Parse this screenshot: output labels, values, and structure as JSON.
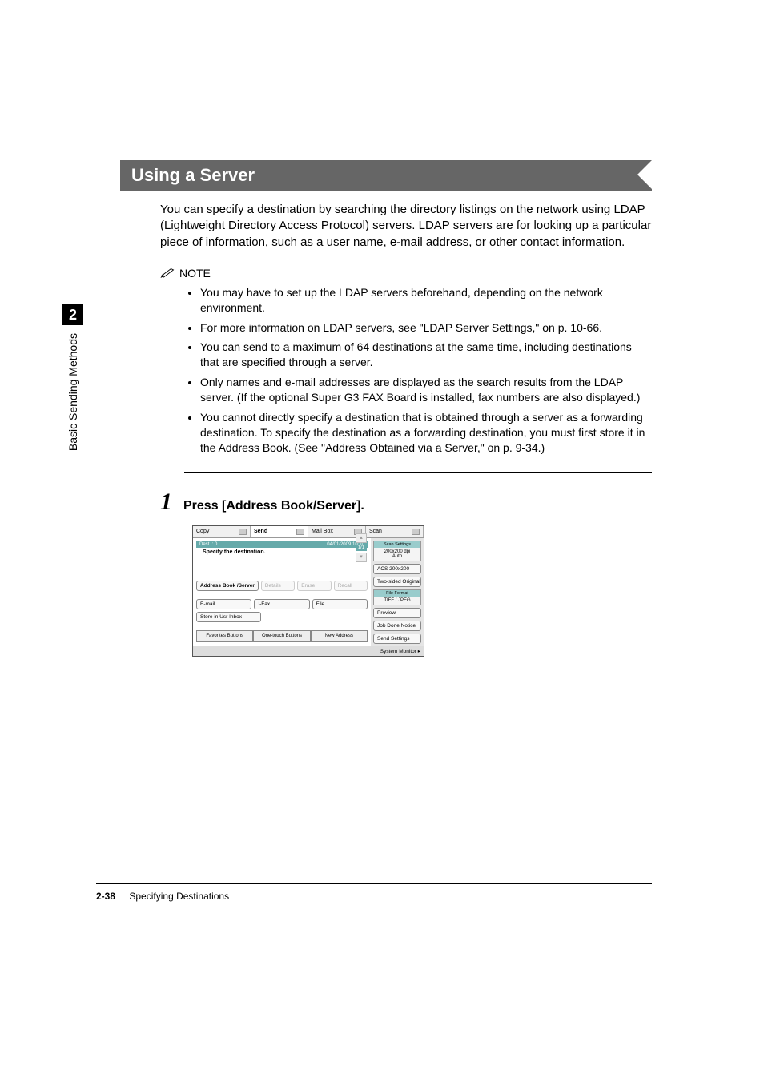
{
  "header": {
    "title": "Using a Server"
  },
  "sidetab": {
    "chapter": "2",
    "label": "Basic Sending Methods"
  },
  "intro": "You can specify a destination by searching the directory listings on the network using LDAP (Lightweight Directory Access Protocol) servers. LDAP servers are for looking up a particular piece of information, such as a user name, e-mail address, or other contact information.",
  "note": {
    "label": "NOTE",
    "items": [
      "You may have to set up the LDAP servers beforehand, depending on the network environment.",
      "For more information on LDAP servers, see \"LDAP Server Settings,\" on p. 10-66.",
      "You can send to a maximum of 64 destinations at the same time, including destinations that are specified through a server.",
      "Only names and e-mail addresses are displayed as the search results from the LDAP server. (If the optional Super G3 FAX Board is installed, fax numbers are also displayed.)",
      "You cannot directly specify a destination that is obtained through a server as a forwarding destination. To specify the destination as a forwarding destination, you must first store it in the Address Book. (See \"Address Obtained via a Server,\" on p. 9-34.)"
    ]
  },
  "step": {
    "number": "1",
    "text": "Press [Address Book/Server]."
  },
  "screenshot": {
    "tabs": {
      "copy": "Copy",
      "send": "Send",
      "mailbox": "Mail Box",
      "scan": "Scan"
    },
    "statusbar": {
      "left": "Dest. :  0",
      "right": "04/01/2009 10:10"
    },
    "prompt": "Specify the destination.",
    "pager": {
      "up": "▴",
      "indicator": "1/1",
      "down": "▾"
    },
    "mainbuttons": {
      "addressbook": "Address Book /Server",
      "details": "Details",
      "erase": "Erase",
      "recall": "Recall",
      "email": "E-mail",
      "ifax": "I-Fax",
      "file": "File",
      "storeinbox": "Store in Usr Inbox"
    },
    "bottomtabs": {
      "favorites": "Favorites Buttons",
      "onetouch": "One-touch Buttons",
      "newaddress": "New Address"
    },
    "side": {
      "scansettings_title": "Scan Settings",
      "resolution": "200x200 dpi",
      "auto": "Auto",
      "acs": "ACS 200x200",
      "twosided": "Two-sided Original",
      "fileformat_title": "File Format",
      "fileformat": "TIFF / JPEG",
      "preview": "Preview",
      "jobdone": "Job Done Notice",
      "sendsettings": "Send Settings"
    },
    "sysmon": "System Monitor"
  },
  "footer": {
    "pagenum": "2-38",
    "section": "Specifying Destinations"
  }
}
